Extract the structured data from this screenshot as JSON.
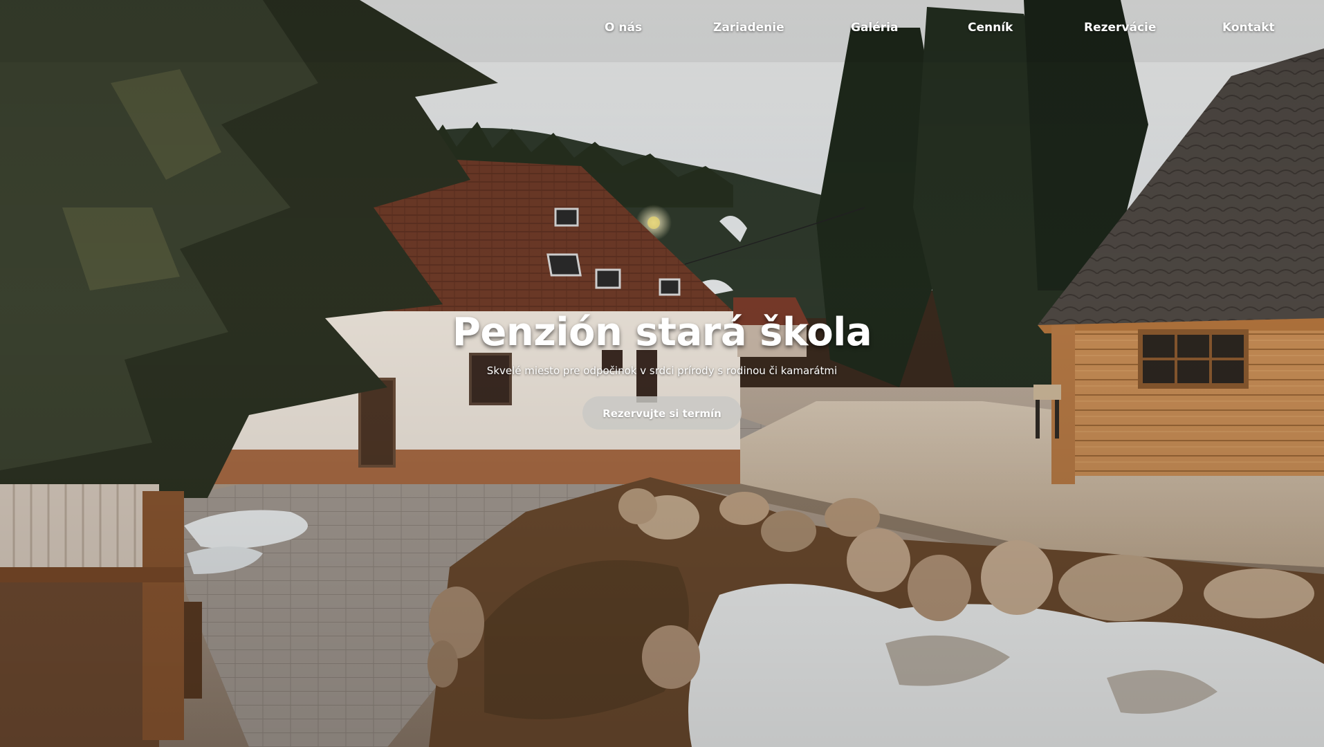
{
  "nav": {
    "items": [
      {
        "label": "O nás"
      },
      {
        "label": "Zariadenie"
      },
      {
        "label": "Galéria"
      },
      {
        "label": "Cenník"
      },
      {
        "label": "Rezervácie"
      },
      {
        "label": "Kontakt"
      }
    ]
  },
  "hero": {
    "title": "Penzión stará škola",
    "subtitle": "Skvelé miesto pre odpočinok v srdci prírody s rodinou či kamarátmi",
    "cta_label": "Rezervujte si termín",
    "image": "mountain-guesthouse-photo"
  },
  "colors": {
    "nav_text": "#ffffff",
    "cta_bg": "#c8c8c4",
    "title_text": "#ffffff"
  }
}
